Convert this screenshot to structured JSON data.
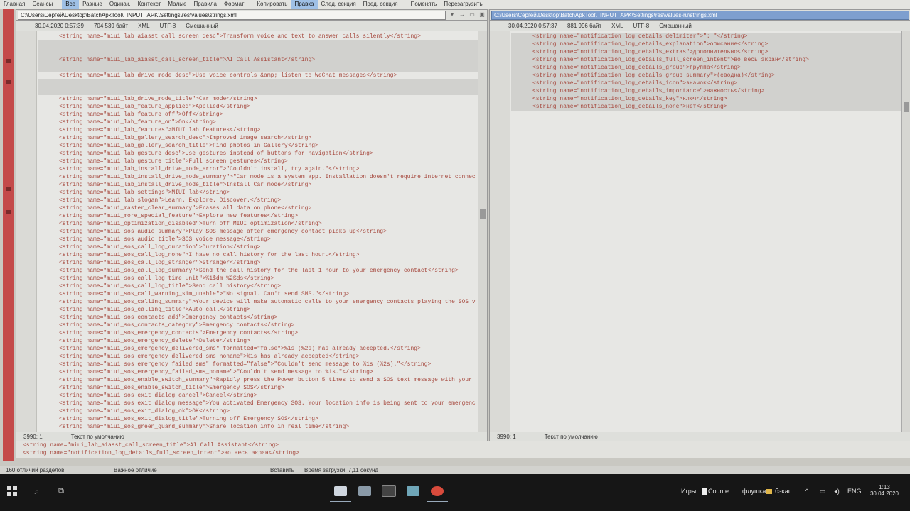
{
  "menu": [
    "Главная",
    "Сеансы",
    "",
    "Все",
    "Разные",
    "Одинак.",
    "Контекст",
    "Малые",
    "Правила",
    "Формат",
    "",
    "Копировать",
    "Правка",
    "След. секция",
    "Пред. секция",
    "",
    "Поменять",
    "Перезагрузить"
  ],
  "left": {
    "path": "C:\\Users\\Сергей\\Desktop\\BatchApkTool\\_INPUT_APK\\Settings\\res\\values\\strings.xml",
    "date": "30.04.2020 0:57:39",
    "size": "704 539 байт",
    "format": "XML",
    "encoding": "UTF-8",
    "lineend": "Смешанный",
    "status_pos": "3990: 1",
    "status_text": "Текст по умолчанию",
    "lines": [
      {
        "t": "<string name=\"miui_lab_aiasst_call_screen_desc\">Transform voice and text to answer calls silently</string>",
        "d": false
      },
      {
        "t": "",
        "d": true
      },
      {
        "t": "",
        "d": true
      },
      {
        "t": "<string name=\"miui_lab_aiasst_call_screen_title\">AI Call Assistant</string>",
        "d": true
      },
      {
        "t": "",
        "d": true
      },
      {
        "t": "<string name=\"miui_lab_drive_mode_desc\">Use voice controls &amp; listen to WeChat messages</string>",
        "d": false
      },
      {
        "t": "",
        "d": true
      },
      {
        "t": "",
        "d": true
      },
      {
        "t": "<string name=\"miui_lab_drive_mode_title\">Car mode</string>",
        "d": false
      },
      {
        "t": "<string name=\"miui_lab_feature_applied\">Applied</string>",
        "d": false
      },
      {
        "t": "<string name=\"miui_lab_feature_off\">Off</string>",
        "d": false
      },
      {
        "t": "<string name=\"miui_lab_feature_on\">On</string>",
        "d": false
      },
      {
        "t": "<string name=\"miui_lab_features\">MIUI lab features</string>",
        "d": false
      },
      {
        "t": "<string name=\"miui_lab_gallery_search_desc\">Improved image search</string>",
        "d": false
      },
      {
        "t": "<string name=\"miui_lab_gallery_search_title\">Find photos in Gallery</string>",
        "d": false
      },
      {
        "t": "<string name=\"miui_lab_gesture_desc\">Use gestures instead of buttons for navigation</string>",
        "d": false
      },
      {
        "t": "<string name=\"miui_lab_gesture_title\">Full screen gestures</string>",
        "d": false
      },
      {
        "t": "<string name=\"miui_lab_install_drive_mode_error\">\"Couldn't install, try again.\"</string>",
        "d": false
      },
      {
        "t": "<string name=\"miui_lab_install_drive_mode_summary\">\"Car mode is a system app. Installation doesn't require internet connec",
        "d": false
      },
      {
        "t": "<string name=\"miui_lab_install_drive_mode_title\">Install Car mode</string>",
        "d": false
      },
      {
        "t": "<string name=\"miui_lab_settings\">MIUI lab</string>",
        "d": false
      },
      {
        "t": "<string name=\"miui_lab_slogan\">Learn. Explore. Discover.</string>",
        "d": false
      },
      {
        "t": "<string name=\"miui_master_clear_summary\">Erases all data on phone</string>",
        "d": false
      },
      {
        "t": "<string name=\"miui_more_special_feature\">Explore new features</string>",
        "d": false
      },
      {
        "t": "<string name=\"miui_optimization_disabled\">Turn off MIUI optimization</string>",
        "d": false
      },
      {
        "t": "<string name=\"miui_sos_audio_summary\">Play SOS message after emergency contact picks up</string>",
        "d": false
      },
      {
        "t": "<string name=\"miui_sos_audio_title\">SOS voice message</string>",
        "d": false
      },
      {
        "t": "<string name=\"miui_sos_call_log_duration\">Duration</string>",
        "d": false
      },
      {
        "t": "<string name=\"miui_sos_call_log_none\">I have no call history for the last hour.</string>",
        "d": false
      },
      {
        "t": "<string name=\"miui_sos_call_log_stranger\">Stranger</string>",
        "d": false
      },
      {
        "t": "<string name=\"miui_sos_call_log_summary\">Send the call history for the last 1 hour to your emergency contact</string>",
        "d": false
      },
      {
        "t": "<string name=\"miui_sos_call_log_time_unit\">%1$dm %2$ds</string>",
        "d": false
      },
      {
        "t": "<string name=\"miui_sos_call_log_title\">Send call history</string>",
        "d": false
      },
      {
        "t": "<string name=\"miui_sos_call_warning_sim_unable\">\"No signal. Can't send SMS.\"</string>",
        "d": false
      },
      {
        "t": "<string name=\"miui_sos_calling_summary\">Your device will make automatic calls to your emergency contacts playing the SOS v",
        "d": false
      },
      {
        "t": "<string name=\"miui_sos_calling_title\">Auto call</string>",
        "d": false
      },
      {
        "t": "<string name=\"miui_sos_contacts_add\">Emergency contacts</string>",
        "d": false
      },
      {
        "t": "<string name=\"miui_sos_contacts_category\">Emergency contacts</string>",
        "d": false
      },
      {
        "t": "<string name=\"miui_sos_emergency_contacts\">Emergency contacts</string>",
        "d": false
      },
      {
        "t": "<string name=\"miui_sos_emergency_delete\">Delete</string>",
        "d": false
      },
      {
        "t": "<string name=\"miui_sos_emergency_delivered_sms\" formatted=\"false\">%1s (%2s) has already accepted.</string>",
        "d": false
      },
      {
        "t": "<string name=\"miui_sos_emergency_delivered_sms_noname\">%1s has already accepted</string>",
        "d": false
      },
      {
        "t": "<string name=\"miui_sos_emergency_failed_sms\" formatted=\"false\">\"Couldn't send message to %1s (%2s).\"</string>",
        "d": false
      },
      {
        "t": "<string name=\"miui_sos_emergency_failed_sms_noname\">\"Couldn't send message to %1s.\"</string>",
        "d": false
      },
      {
        "t": "<string name=\"miui_sos_enable_switch_summary\">Rapidly press the Power button 5 times to send a SOS text message with your",
        "d": false
      },
      {
        "t": "<string name=\"miui_sos_enable_switch_title\">Emergency SOS</string>",
        "d": false
      },
      {
        "t": "<string name=\"miui_sos_exit_dialog_cancel\">Cancel</string>",
        "d": false
      },
      {
        "t": "<string name=\"miui_sos_exit_dialog_message\">You activated Emergency SOS. Your location info is being sent to your emergenc",
        "d": false
      },
      {
        "t": "<string name=\"miui_sos_exit_dialog_ok\">OK</string>",
        "d": false
      },
      {
        "t": "<string name=\"miui_sos_exit_dialog_title\">Turning off Emergency SOS</string>",
        "d": false
      },
      {
        "t": "<string name=\"miui_sos_green_guard_summary\">Share location info in real time</string>",
        "d": false
      }
    ]
  },
  "right": {
    "path": "C:\\Users\\Сергей\\Desktop\\BatchApkTool\\_INPUT_APK\\Settings\\res\\values-ru\\strings.xml",
    "date": "30.04.2020 0:57:37",
    "size": "881 996 байт",
    "format": "XML",
    "encoding": "UTF-8",
    "lineend": "Смешанный",
    "status_pos": "3990: 1",
    "status_text": "Текст по умолчанию",
    "lines": [
      {
        "t": "<string name=\"notification_log_details_delimiter\">\": \"</string>",
        "d": true
      },
      {
        "t": "<string name=\"notification_log_details_explanation\">описание</string>",
        "d": true
      },
      {
        "t": "<string name=\"notification_log_details_extras\">дополнительно</string>",
        "d": true
      },
      {
        "t": "<string name=\"notification_log_details_full_screen_intent\">во весь экран</string>",
        "d": true
      },
      {
        "t": "<string name=\"notification_log_details_group\">группа</string>",
        "d": true
      },
      {
        "t": "<string name=\"notification_log_details_group_summary\">(сводка)</string>",
        "d": true
      },
      {
        "t": "<string name=\"notification_log_details_icon\">значок</string>",
        "d": true
      },
      {
        "t": "<string name=\"notification_log_details_importance\">важность</string>",
        "d": true
      },
      {
        "t": "<string name=\"notification_log_details_key\">ключ</string>",
        "d": true
      },
      {
        "t": "<string name=\"notification_log_details_none\">нет</string>",
        "d": true
      }
    ]
  },
  "compare": [
    "<string name=\"miui_lab_aiasst_call_screen_title\">AI Call Assistant</string>",
    "<string name=\"notification_log_details_full_screen_intent\">во весь экран</string>"
  ],
  "app_status": {
    "diff_count": "160 отличий разделов",
    "diff_kind": "Важное отличие",
    "mode": "Вставить",
    "load_time": "Время загрузки: 7,11 секунд"
  },
  "taskbar": {
    "games": "Игры",
    "counte": "Counte",
    "flash": "флушка",
    "folder": "бэкаг",
    "lang": "ENG",
    "date": "30.04.2020",
    "time": "1:13"
  }
}
